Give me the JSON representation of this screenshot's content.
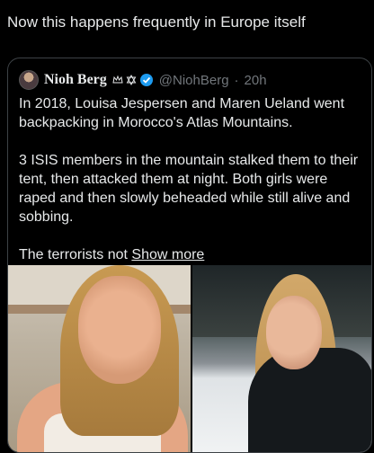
{
  "post": {
    "text": "Now this happens frequently in Europe itself"
  },
  "quote": {
    "display_name": "Nioh Berg",
    "handle": "@NiohBerg",
    "separator": "·",
    "time": "20h",
    "paragraphs": [
      "In 2018, Louisa Jespersen and Maren Ueland went backpacking in Morocco's Atlas Mountains.",
      "3 ISIS members in the mountain stalked them to their tent, then attacked them at night. Both girls were raped and then slowly beheaded while still alive and sobbing."
    ],
    "truncated_text": "The terrorists not",
    "show_more": "Show more"
  },
  "icons": {
    "crown": "crown-icon",
    "star": "star-of-david-icon",
    "verified": "verified-badge-icon",
    "verified_color": "#1d9bf0"
  },
  "photos": [
    {
      "name": "photo-left",
      "description_visible": false
    },
    {
      "name": "photo-right",
      "description_visible": false
    }
  ]
}
